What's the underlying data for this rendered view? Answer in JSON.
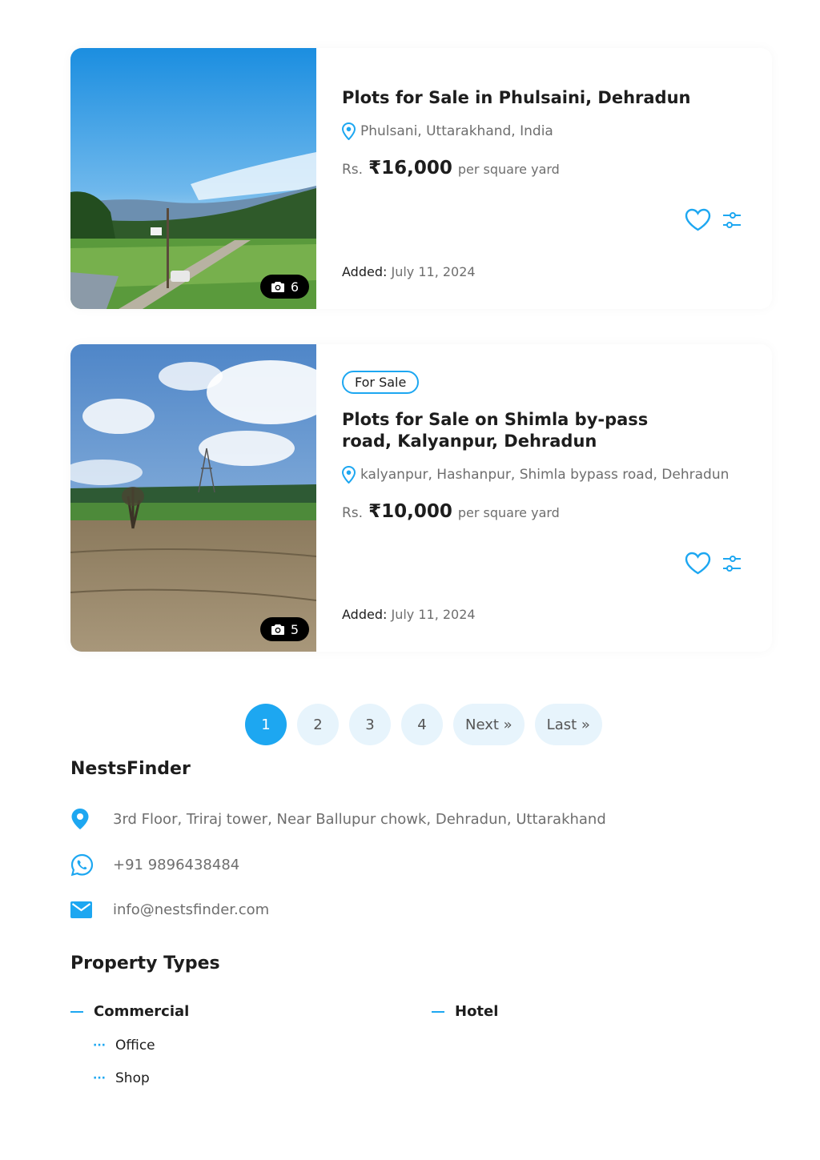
{
  "listings": [
    {
      "title": "Plots for Sale in Phulsaini, Dehradun",
      "location": "Phulsani, Uttarakhand, India",
      "currency_prefix": "Rs.",
      "price": "₹16,000",
      "price_unit": "per square yard",
      "photo_count": "6",
      "added_label": "Added:",
      "added_date": "July 11, 2024"
    },
    {
      "tag": "For Sale",
      "title": "Plots for Sale on Shimla by-pass road, Kalyanpur, Dehradun",
      "location": "kalyanpur, Hashanpur, Shimla bypass road, Dehradun",
      "currency_prefix": "Rs.",
      "price": "₹10,000",
      "price_unit": "per square yard",
      "photo_count": "5",
      "added_label": "Added:",
      "added_date": "July 11, 2024"
    }
  ],
  "pagination": {
    "pages": [
      "1",
      "2",
      "3",
      "4"
    ],
    "current": "1",
    "next_label": "Next »",
    "last_label": "Last »"
  },
  "footer": {
    "brand": "NestsFinder",
    "address": "3rd Floor, Triraj tower, Near Ballupur chowk, Dehradun, Uttarakhand",
    "phone": "+91 9896438484",
    "email": "info@nestsfinder.com"
  },
  "property_types": {
    "title": "Property Types",
    "categories": [
      {
        "label": "Commercial",
        "children": [
          "Office",
          "Shop"
        ]
      },
      {
        "label": "Hotel",
        "children": []
      }
    ]
  },
  "colors": {
    "accent": "#1da7f1",
    "text": "#1d1d1d",
    "muted": "#6e6e6e",
    "pill_bg": "#e7f4fc"
  },
  "icons": [
    "camera-icon",
    "location-pin-icon",
    "heart-icon",
    "compare-sliders-icon",
    "whatsapp-icon",
    "mail-icon"
  ]
}
